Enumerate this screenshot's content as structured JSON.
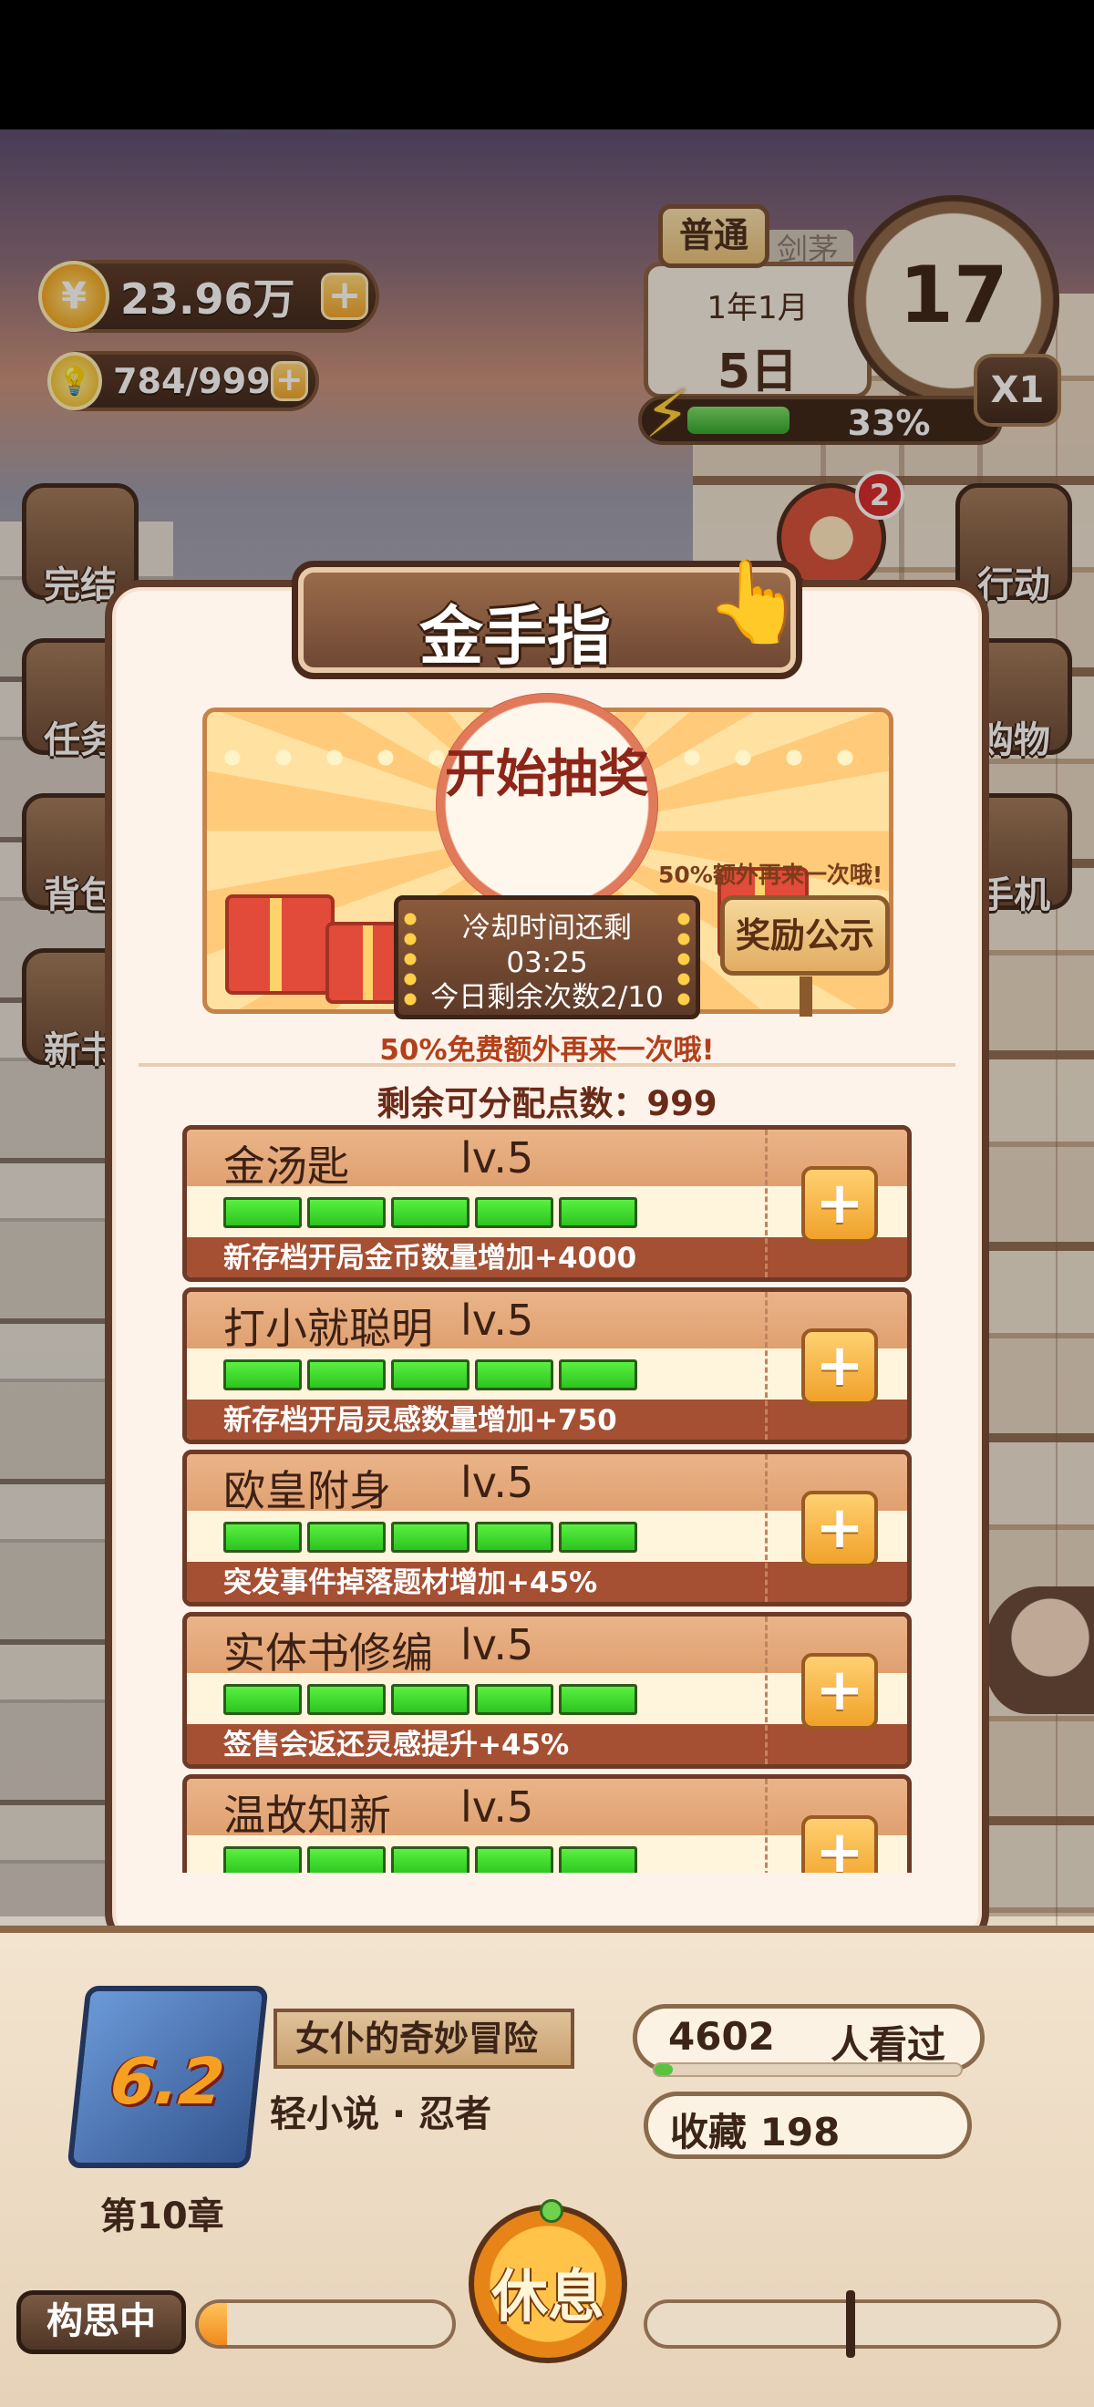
{
  "hud": {
    "coins": "23.96万",
    "coin_symbol": "¥",
    "ideas": "784/999",
    "plus": "+",
    "mode": "普通",
    "mode2": "剑茅",
    "date_month": "1年1月",
    "date_day": "5日",
    "clock_value": "17",
    "speed": "X1",
    "energy_percent_text": "33%",
    "energy_fraction": 0.33
  },
  "side_left": [
    "完结",
    "任务",
    "背包",
    "新书"
  ],
  "side_right": [
    "行动",
    "购物",
    "手机"
  ],
  "notification_count": "2",
  "modal": {
    "title": "金手指",
    "draw_button": "开始抽奖",
    "cooldown_label": "冷却时间还剩",
    "cooldown_time": "03:25",
    "remaining_today": "今日剩余次数2/10",
    "extra_chance": "50%额外再来一次哦!",
    "reward_board": "奖励公示",
    "free_tip": "50%免费额外再来一次哦!",
    "points_label": "剩余可分配点数：999",
    "skills": [
      {
        "name": "金汤匙",
        "level": "lv.5",
        "desc": "新存档开局金币数量增加+4000",
        "bars": 5
      },
      {
        "name": "打小就聪明",
        "level": "lv.5",
        "desc": "新存档开局灵感数量增加+750",
        "bars": 5
      },
      {
        "name": "欧皇附身",
        "level": "lv.5",
        "desc": "突发事件掉落题材增加+45%",
        "bars": 5
      },
      {
        "name": "实体书修编",
        "level": "lv.5",
        "desc": "签售会返还灵感提升+45%",
        "bars": 5
      },
      {
        "name": "温故知新",
        "level": "lv.5",
        "desc": "",
        "bars": 5
      }
    ]
  },
  "book": {
    "score": "6.2",
    "chapter": "第10章",
    "title": "女仆的奇妙冒险",
    "genre": "轻小说 · 忍者",
    "views": "4602",
    "views_unit": "人看过",
    "favorites": "收藏 198"
  },
  "bottom": {
    "status": "构思中",
    "rest": "休息"
  },
  "colors": {
    "accent": "#f0a62a",
    "bar_green": "#2cc420",
    "modal_border": "#5e3a28",
    "badge_red": "#d42a2a"
  }
}
